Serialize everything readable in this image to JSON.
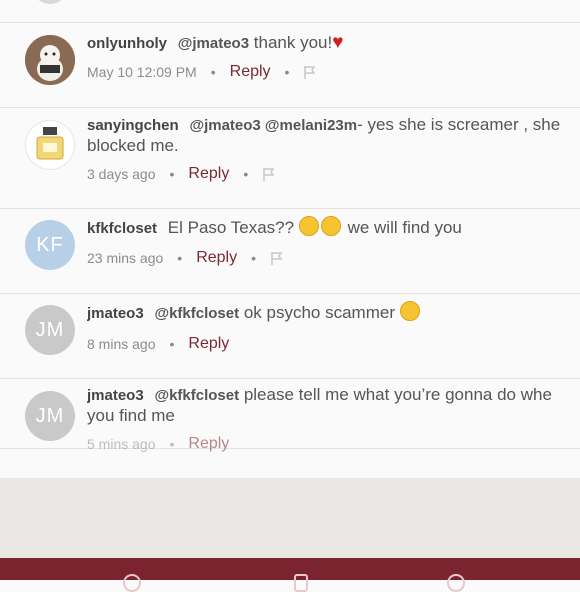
{
  "comments": [
    {
      "username": "onlyunholy",
      "mentions": "@jmateo3",
      "text": "thank you!",
      "timestamp": "May 10 12:09 PM",
      "reply_label": "Reply",
      "avatar": "dog-photo"
    },
    {
      "username": "sanyingchen",
      "mentions": "@jmateo3 @melani23m",
      "text": "- yes she is screamer , she",
      "text_line2": "blocked me.",
      "timestamp": "3 days ago",
      "reply_label": "Reply",
      "avatar": "perfume-photo"
    },
    {
      "username": "kfkfcloset",
      "text_before": "El Paso Texas??",
      "text_after": "we will find you",
      "timestamp": "23 mins ago",
      "reply_label": "Reply",
      "avatar_initials": "KF"
    },
    {
      "username": "jmateo3",
      "mentions": "@kfkfcloset",
      "text": "ok psycho scammer",
      "timestamp": "8 mins ago",
      "reply_label": "Reply",
      "avatar_initials": "JM"
    },
    {
      "username": "jmateo3",
      "mentions": "@kfkfcloset",
      "text": "please tell me what you’re gonna do whe",
      "text_line2": "you find me",
      "timestamp": "5 mins ago",
      "reply_label": "Reply",
      "avatar_initials": "JM"
    }
  ],
  "icons": {
    "flag": "flag-icon",
    "heart": "heart-emoji",
    "smile": "smile-emoji",
    "laugh": "tears-of-joy-emoji"
  },
  "colors": {
    "reply": "#7a2a35",
    "navbar": "#7b2430",
    "heart": "#d02020"
  }
}
